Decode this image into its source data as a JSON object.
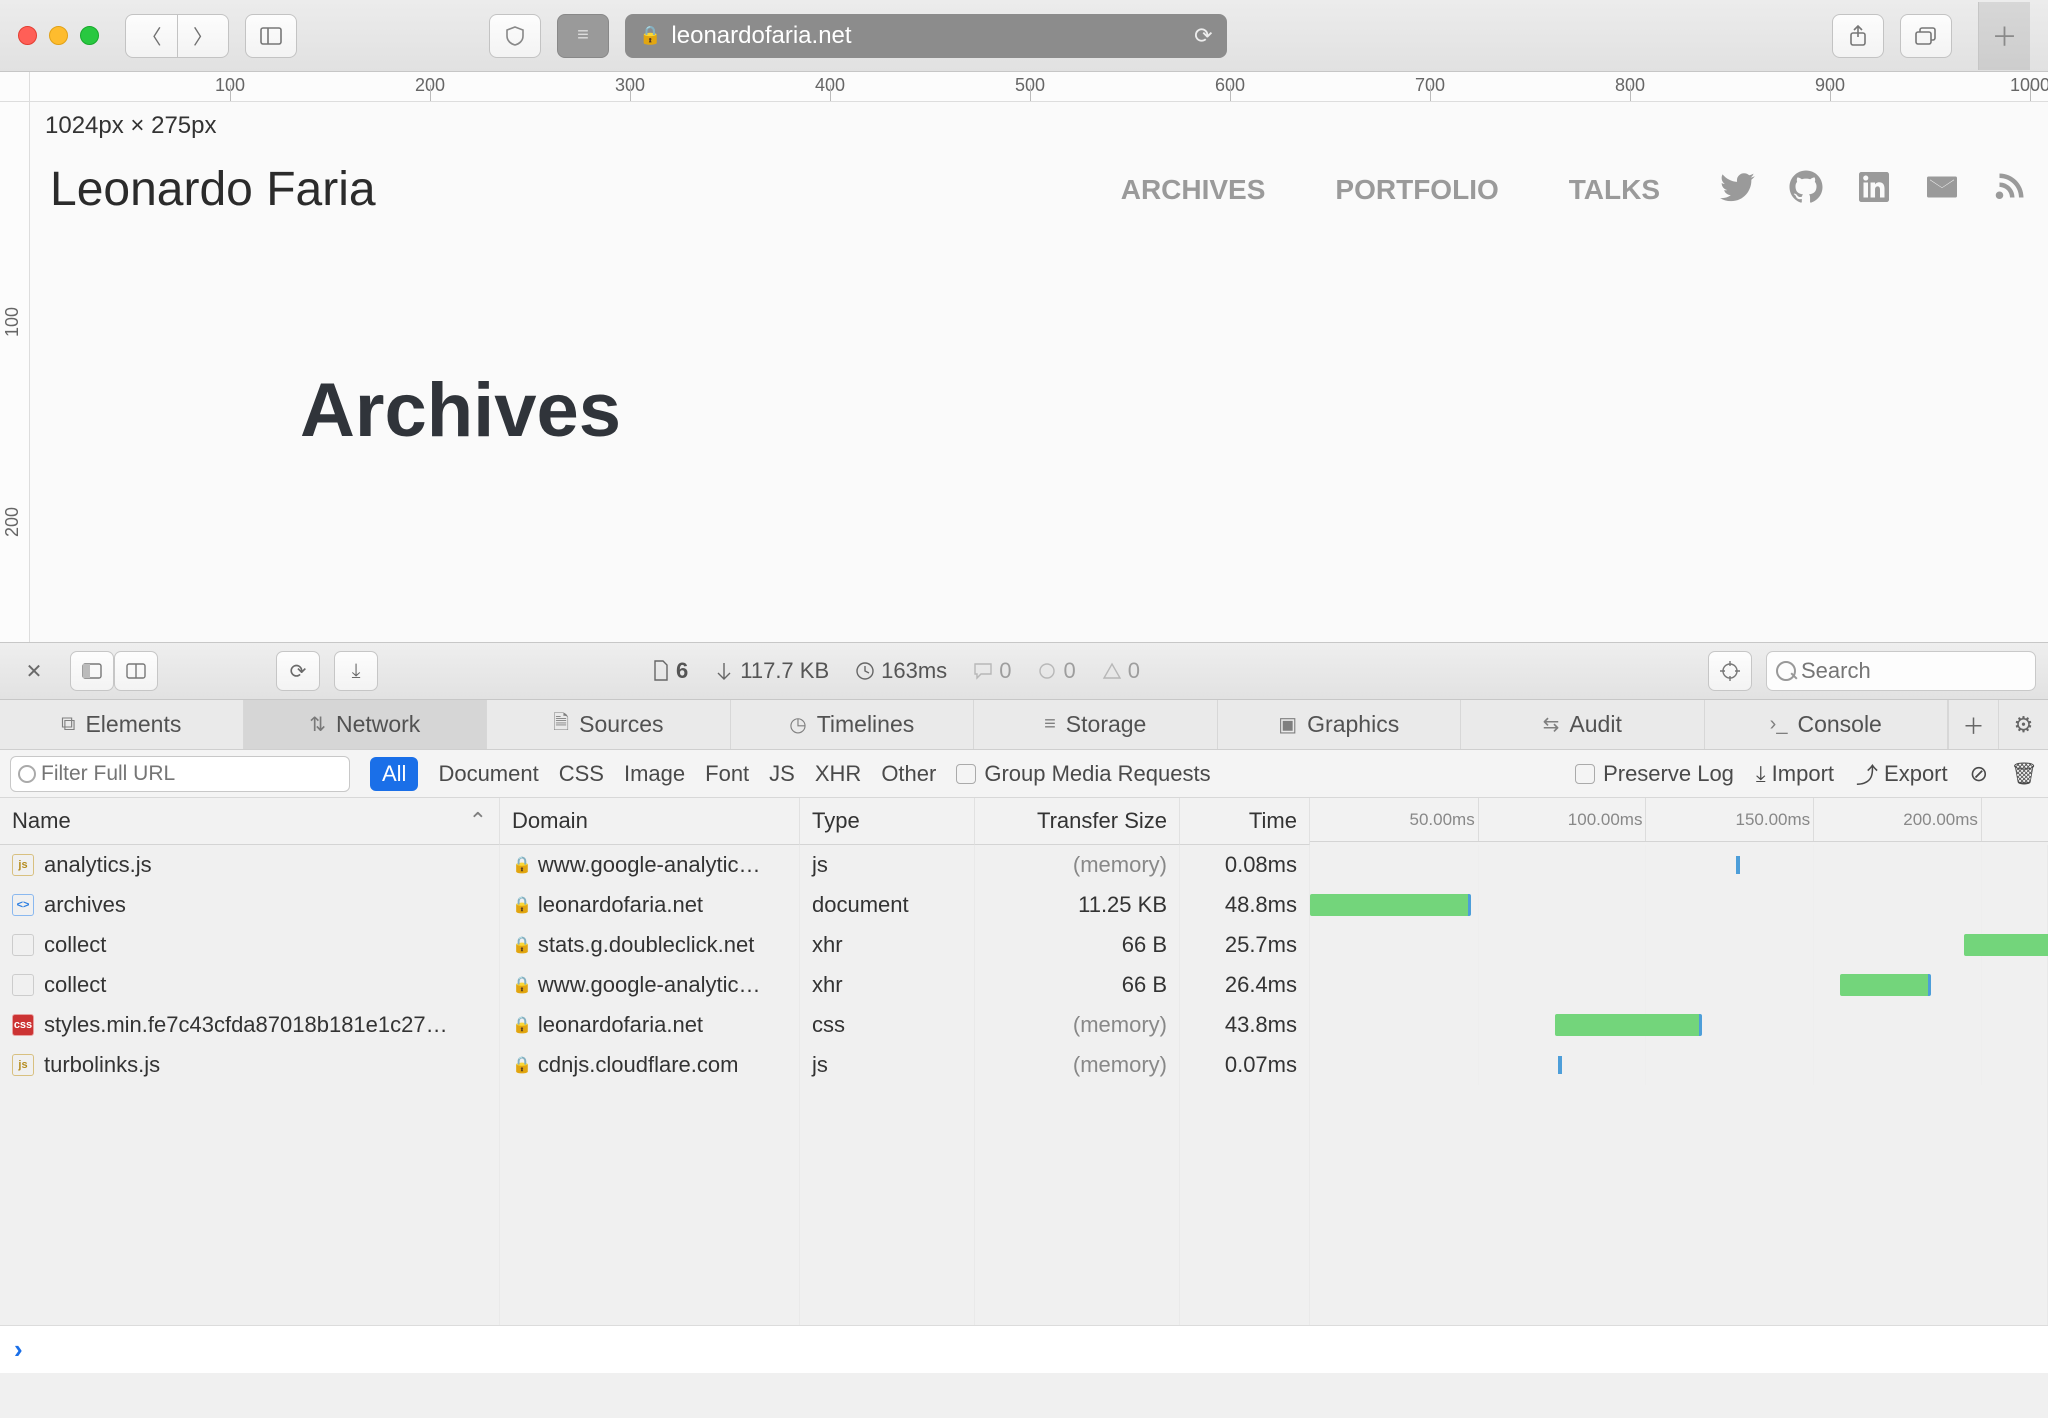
{
  "toolbar": {
    "url_host": "leonardofaria.net"
  },
  "ruler": {
    "h_marks": [
      100,
      200,
      300,
      400,
      500,
      600,
      700,
      800,
      900,
      1000
    ],
    "v_marks": [
      100,
      200
    ]
  },
  "page": {
    "dimensions": "1024px × 275px",
    "site_title": "Leonardo Faria",
    "nav": [
      "ARCHIVES",
      "PORTFOLIO",
      "TALKS"
    ],
    "heading": "Archives"
  },
  "devtools": {
    "summary": {
      "docs": "6",
      "size": "117.7 KB",
      "time": "163ms",
      "log1": "0",
      "log2": "0",
      "log3": "0"
    },
    "search_placeholder": "Search",
    "tabs": [
      "Elements",
      "Network",
      "Sources",
      "Timelines",
      "Storage",
      "Graphics",
      "Audit",
      "Console"
    ],
    "active_tab": "Network",
    "filter": {
      "url_placeholder": "Filter Full URL",
      "types": [
        "All",
        "Document",
        "CSS",
        "Image",
        "Font",
        "JS",
        "XHR",
        "Other"
      ],
      "group_label": "Group Media Requests",
      "preserve_label": "Preserve Log",
      "import_label": "Import",
      "export_label": "Export"
    },
    "columns": [
      "Name",
      "Domain",
      "Type",
      "Transfer Size",
      "Time"
    ],
    "wf_marks": [
      50,
      100,
      150,
      200
    ],
    "rows": [
      {
        "icon": "js",
        "name": "analytics.js",
        "domain": "www.google-analytic…",
        "type": "js",
        "size": "(memory)",
        "size_mem": true,
        "time": "0.08ms",
        "bar": null,
        "tick": 127
      },
      {
        "icon": "doc",
        "name": "archives",
        "domain": "leonardofaria.net",
        "type": "document",
        "size": "11.25 KB",
        "size_mem": false,
        "time": "48.8ms",
        "bar": [
          0,
          48
        ],
        "tick": null
      },
      {
        "icon": "blank",
        "name": "collect",
        "domain": "stats.g.doubleclick.net",
        "type": "xhr",
        "size": "66 B",
        "size_mem": false,
        "time": "25.7ms",
        "bar": [
          195,
          26
        ],
        "tick": null
      },
      {
        "icon": "blank",
        "name": "collect",
        "domain": "www.google-analytic…",
        "type": "xhr",
        "size": "66 B",
        "size_mem": false,
        "time": "26.4ms",
        "bar": [
          158,
          27
        ],
        "tick": null
      },
      {
        "icon": "css",
        "name": "styles.min.fe7c43cfda87018b181e1c27…",
        "domain": "leonardofaria.net",
        "type": "css",
        "size": "(memory)",
        "size_mem": true,
        "time": "43.8ms",
        "bar": [
          73,
          44
        ],
        "tick": null
      },
      {
        "icon": "js",
        "name": "turbolinks.js",
        "domain": "cdnjs.cloudflare.com",
        "type": "js",
        "size": "(memory)",
        "size_mem": true,
        "time": "0.07ms",
        "bar": null,
        "tick": 74
      }
    ]
  }
}
